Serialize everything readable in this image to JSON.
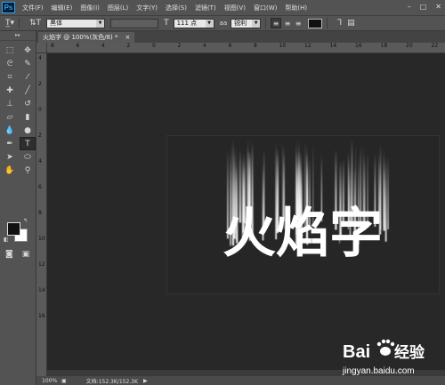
{
  "app": {
    "logo": "Ps"
  },
  "menubar": {
    "items": [
      "文件(F)",
      "编辑(E)",
      "图像(I)",
      "图层(L)",
      "文字(Y)",
      "选择(S)",
      "滤镜(T)",
      "视图(V)",
      "窗口(W)",
      "帮助(H)"
    ]
  },
  "options": {
    "font_family": "黑体",
    "font_style": "-",
    "font_size": "111 点",
    "aa_label": "aa",
    "antialias": "锐利",
    "text_color": "#111111"
  },
  "document": {
    "tab_title": "火焰字 @ 100%(灰色/8) *",
    "tab_close": "×",
    "canvas_text": "火焰字",
    "canvas_bg": "#262626",
    "flame_color": "#ffffff"
  },
  "rulers": {
    "h": [
      "8",
      "6",
      "4",
      "2",
      "0",
      "2",
      "4",
      "6",
      "8",
      "10",
      "12",
      "14",
      "16",
      "18",
      "20",
      "22"
    ],
    "v": [
      "4",
      "2",
      "0",
      "2",
      "4",
      "6",
      "8",
      "10",
      "12",
      "14",
      "16"
    ]
  },
  "status": {
    "zoom": "100%",
    "doc_info": "文档:152.3K/152.3K"
  },
  "watermark": {
    "brand": "Bai",
    "brand2": "经验",
    "url": "jingyan.baidu.com"
  },
  "colors": {
    "foreground": "#111111",
    "background": "#ffffff"
  }
}
